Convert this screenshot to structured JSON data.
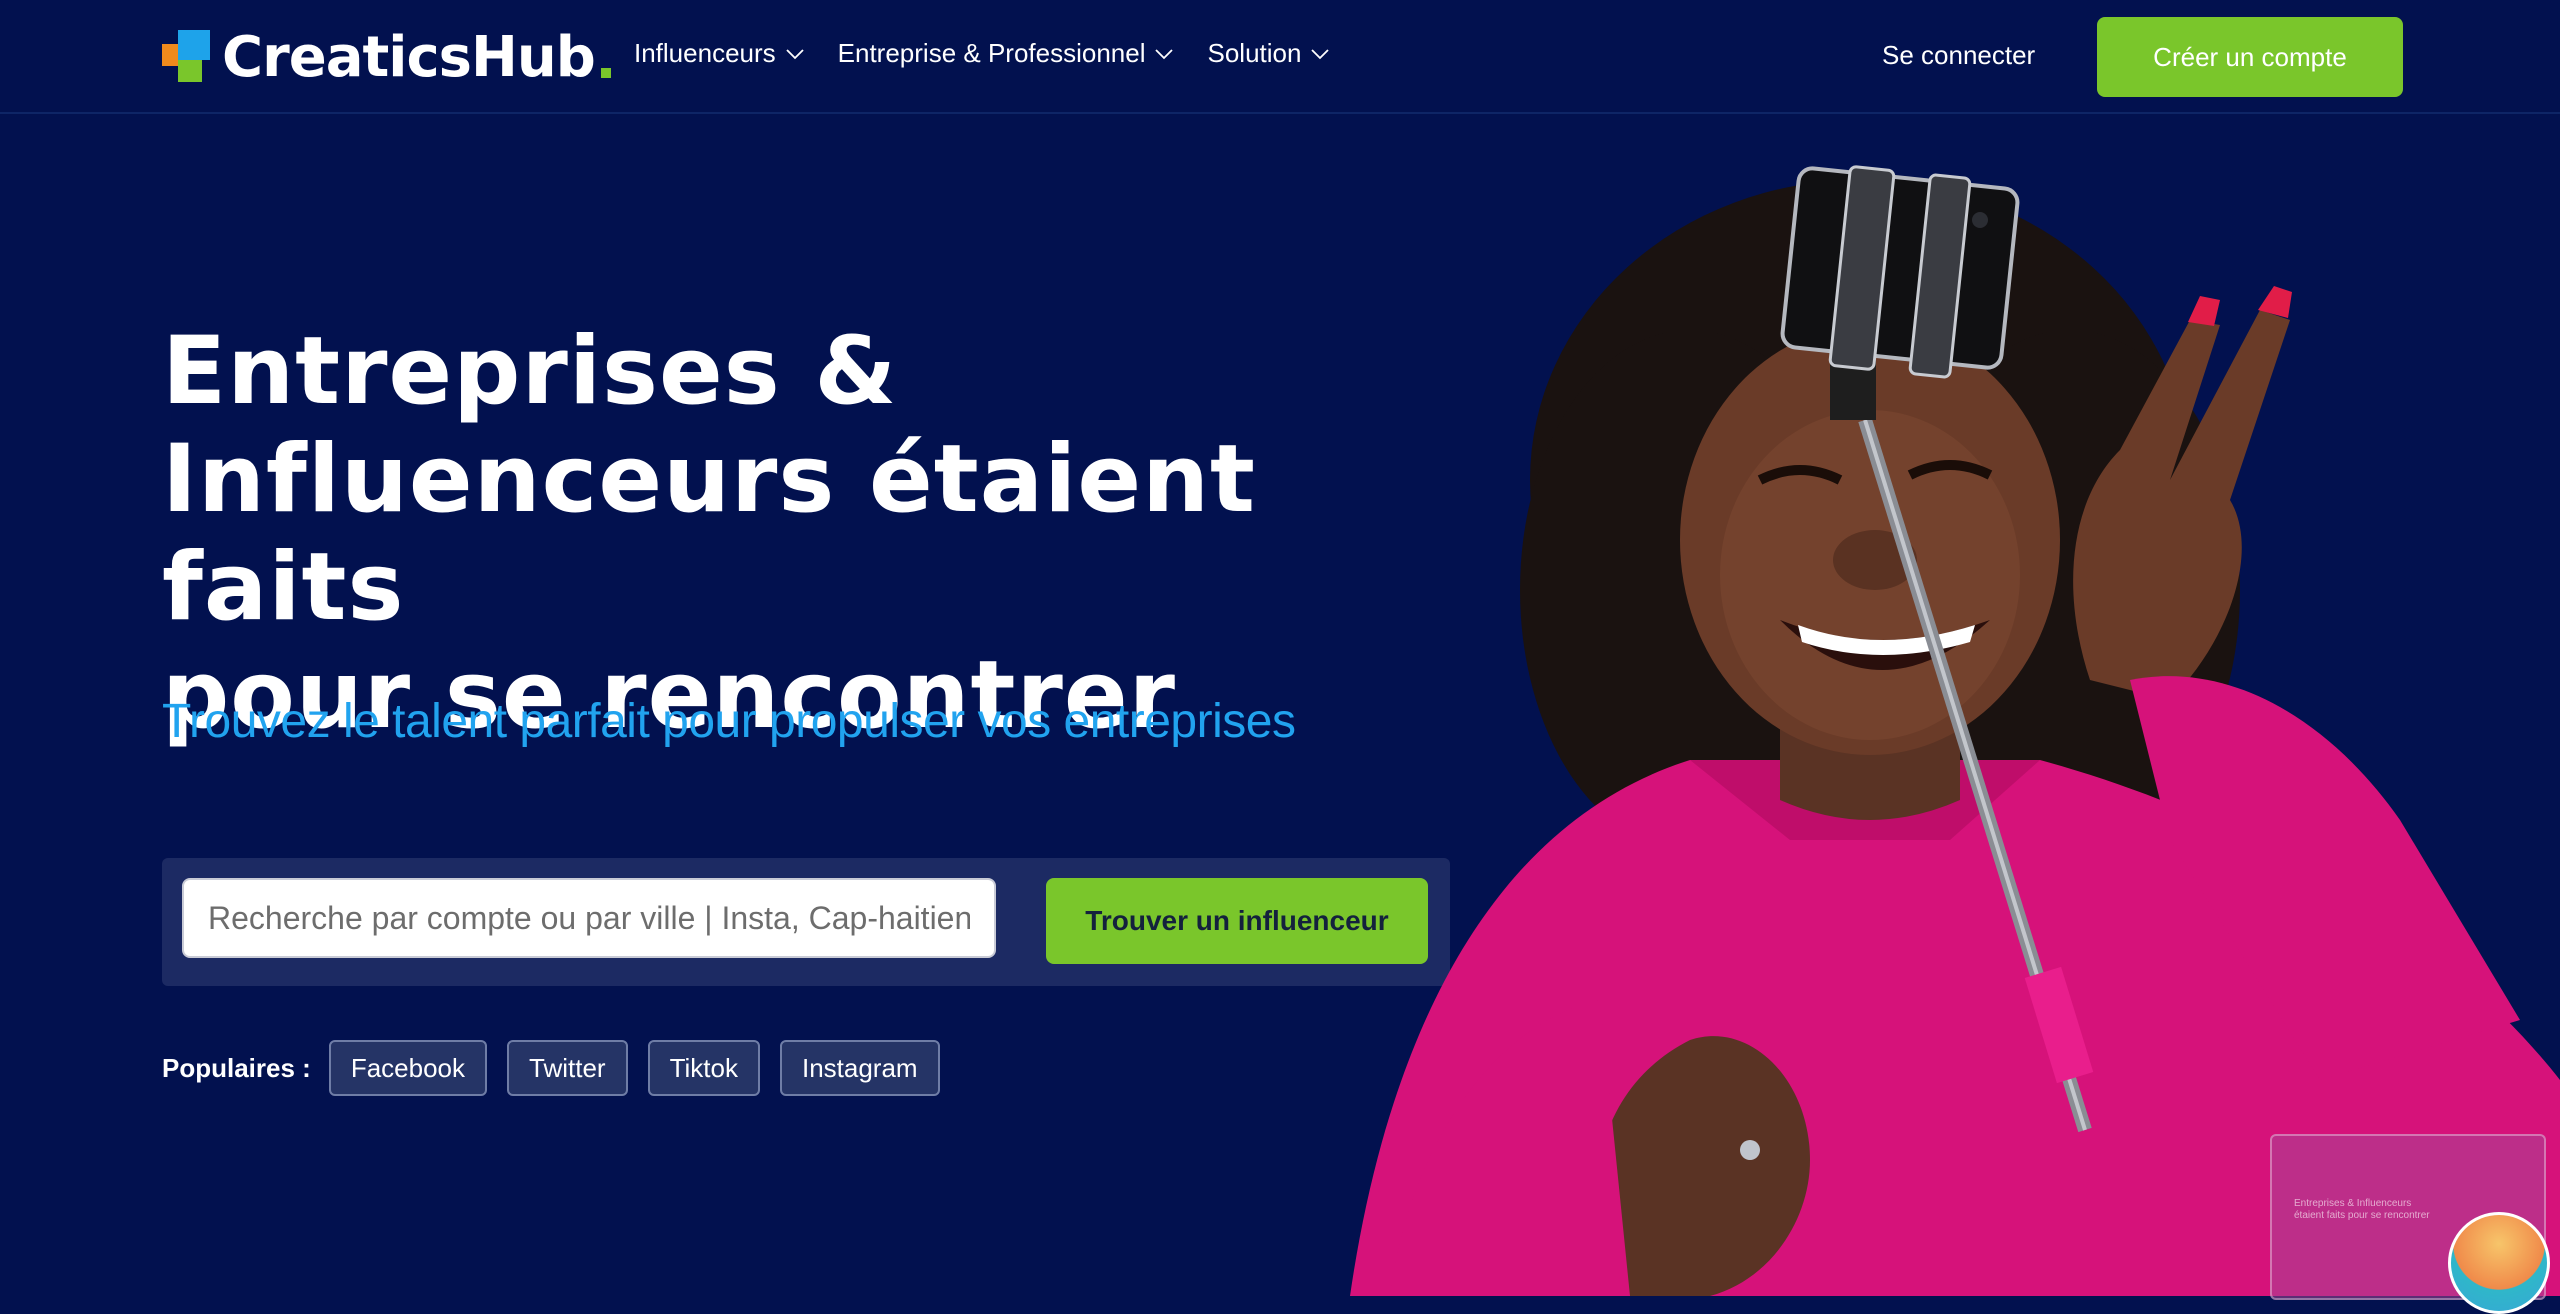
{
  "brand": {
    "name": "CreaticsHub",
    "colors": {
      "accent": "#7ac62b",
      "blue": "#21a3ef",
      "orange": "#f08a1c",
      "navy": "#02114f"
    }
  },
  "nav": {
    "items": [
      {
        "label": "Influenceurs",
        "icon": "chevron-down-icon"
      },
      {
        "label": "Entreprise & Professionnel",
        "icon": "chevron-down-icon"
      },
      {
        "label": "Solution",
        "icon": "chevron-down-icon"
      }
    ],
    "login": "Se connecter",
    "signup": "Créer un compte"
  },
  "hero": {
    "title_lines": [
      "Entreprises &",
      "Influenceurs étaient faits",
      "pour se rencontrer"
    ],
    "subtitle": "Trouvez le talent parfait pour propulser vos entreprises"
  },
  "search": {
    "placeholder": "Recherche par compte ou par ville | Insta, Cap-haitien",
    "button": "Trouver un influenceur"
  },
  "popular": {
    "label": "Populaires :",
    "chips": [
      "Facebook",
      "Twitter",
      "Tiktok",
      "Instagram"
    ]
  },
  "widget": {
    "preview_text": "Entreprises & Influenceurs étaient faits pour se rencontrer"
  }
}
